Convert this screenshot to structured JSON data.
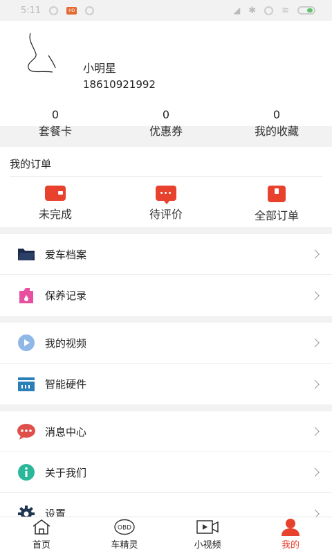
{
  "statusbar": {
    "time": "5:11",
    "chip": "HD"
  },
  "profile": {
    "username": "小明星",
    "phone": "18610921992",
    "stats": [
      {
        "num": "0",
        "label": "套餐卡"
      },
      {
        "num": "0",
        "label": "优惠券"
      },
      {
        "num": "0",
        "label": "我的收藏"
      }
    ]
  },
  "orders": {
    "title": "我的订单",
    "items": [
      {
        "label": "未完成",
        "icon": "wallet-icon"
      },
      {
        "label": "待评价",
        "icon": "comment-icon"
      },
      {
        "label": "全部订单",
        "icon": "order-box-icon"
      }
    ]
  },
  "menu": {
    "group1": [
      {
        "label": "爱车档案",
        "icon": "folder-icon"
      },
      {
        "label": "保养记录",
        "icon": "oil-can-icon"
      }
    ],
    "group2": [
      {
        "label": "我的视频",
        "icon": "play-icon"
      },
      {
        "label": "智能硬件",
        "icon": "hardware-icon"
      }
    ],
    "group3": [
      {
        "label": "消息中心",
        "icon": "message-icon"
      },
      {
        "label": "关于我们",
        "icon": "info-icon"
      },
      {
        "label": "设置",
        "icon": "gear-icon"
      }
    ]
  },
  "tabs": [
    {
      "label": "首页",
      "icon": "home-icon",
      "active": false
    },
    {
      "label": "车精灵",
      "icon": "obd-icon",
      "active": false
    },
    {
      "label": "小视频",
      "icon": "video-icon",
      "active": false
    },
    {
      "label": "我的",
      "icon": "person-icon",
      "active": true
    }
  ],
  "tab_obd_text": "OBD",
  "colors": {
    "accent": "#e8422f",
    "folder": "#1b2a4a",
    "oil": "#e84fa0",
    "play": "#8fb8e8",
    "hardware": "#2a7fb8",
    "message": "#e0504a",
    "info": "#2bb89a",
    "gear": "#1f3550"
  }
}
